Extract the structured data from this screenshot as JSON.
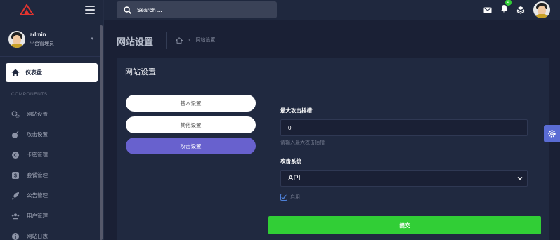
{
  "sidebar": {
    "user": {
      "name": "admin",
      "role": "平台管理员"
    },
    "dashboard_label": "仪表盘",
    "section_title": "COMPONENTS",
    "items": [
      {
        "label": "网站设置",
        "icon": "gears-icon"
      },
      {
        "label": "攻击设置",
        "icon": "bomb-icon"
      },
      {
        "label": "卡密管理",
        "icon": "coin-icon"
      },
      {
        "label": "套餐管理",
        "icon": "money-icon"
      },
      {
        "label": "公告管理",
        "icon": "rocket-icon"
      },
      {
        "label": "用户管理",
        "icon": "users-icon"
      },
      {
        "label": "网站日志",
        "icon": "info-icon"
      }
    ]
  },
  "header": {
    "search_placeholder": "Search ...",
    "notification_count": "4"
  },
  "page": {
    "title": "网站设置",
    "breadcrumb": "网站设置"
  },
  "card": {
    "title": "网站设置",
    "tabs": [
      {
        "label": "基本设置",
        "active": false
      },
      {
        "label": "其他设置",
        "active": false
      },
      {
        "label": "攻击设置",
        "active": true
      }
    ],
    "form": {
      "max_label": "最大攻击插槽:",
      "max_value": "0",
      "max_help": "请输入最大攻击插槽",
      "system_label": "攻击系统",
      "system_value": "API",
      "check_label": "启用",
      "check_checked": true,
      "submit_label": "提交"
    }
  },
  "colors": {
    "background": "#1a2035",
    "panel": "#1f283e",
    "card": "#202940",
    "accent_purple": "#6861ce",
    "accent_green": "#31ce36",
    "logo_red": "#e3342f"
  }
}
